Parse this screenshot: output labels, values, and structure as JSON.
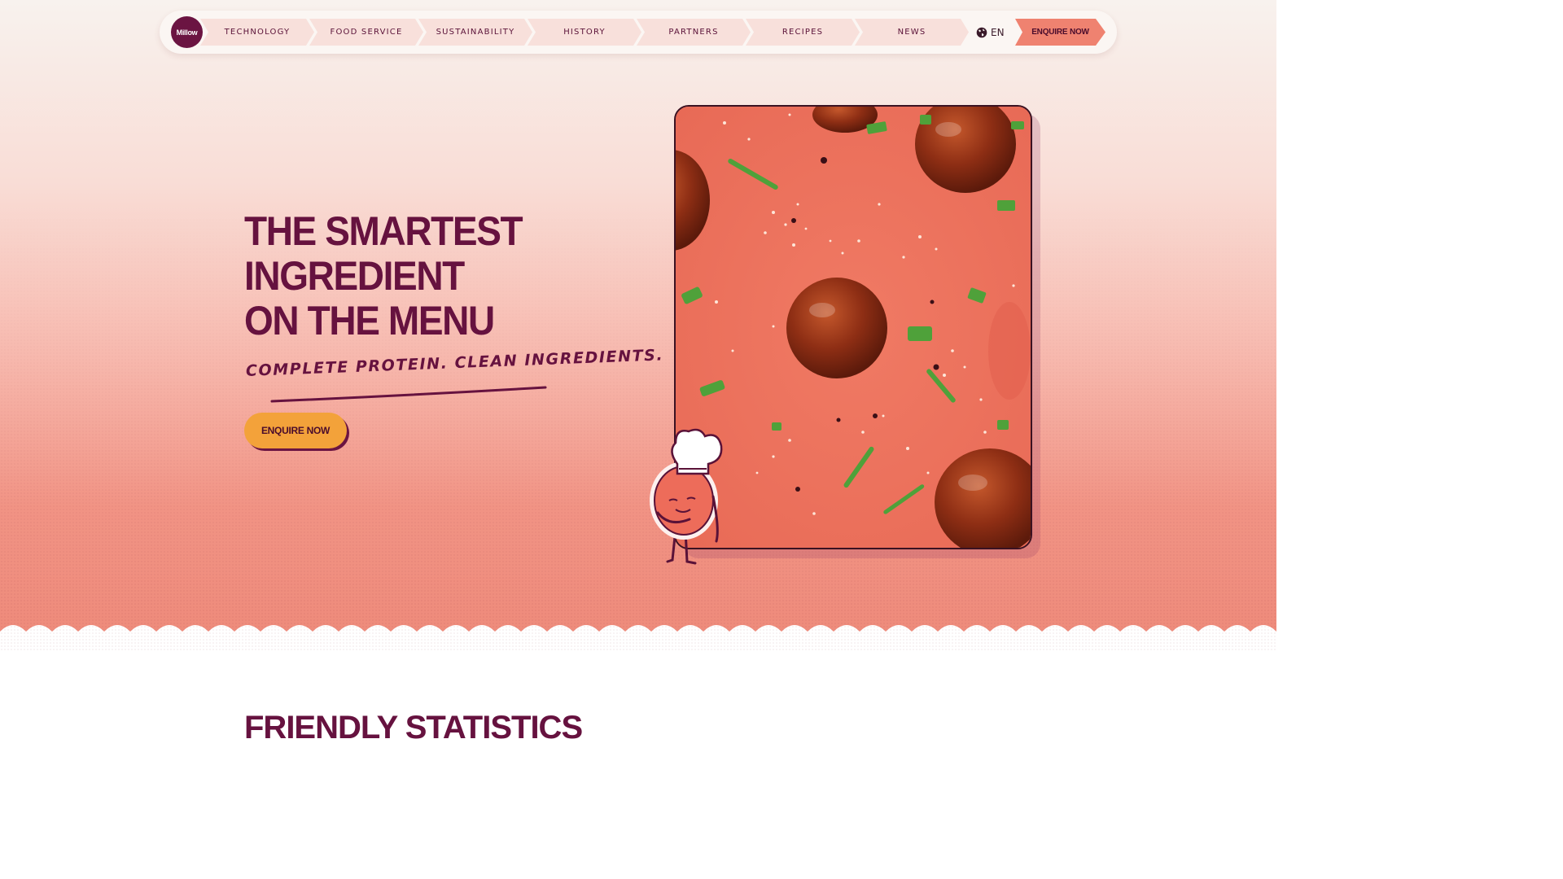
{
  "nav": {
    "logo_text": "Millow",
    "items": [
      {
        "label": "TECHNOLOGY"
      },
      {
        "label": "FOOD SERVICE"
      },
      {
        "label": "SUSTAINABILITY"
      },
      {
        "label": "HISTORY"
      },
      {
        "label": "PARTNERS"
      },
      {
        "label": "RECIPES"
      },
      {
        "label": "NEWS"
      }
    ],
    "language": {
      "icon": "globe-icon",
      "label": "EN"
    },
    "cta_label": "ENQUIRE NOW"
  },
  "hero": {
    "headline": [
      "THE SMARTEST",
      "INGREDIENT",
      "ON THE MENU"
    ],
    "tagline": "COMPLETE PROTEIN. CLEAN INGREDIENTS.",
    "cta_label": "ENQUIRE NOW",
    "image": {
      "subject": "meatballs-photo",
      "mascot": "chef-mascot"
    }
  },
  "next_section": {
    "title_partial": "FRIENDLY STATISTICS"
  },
  "colors": {
    "brand": "#66123f",
    "accent_coral": "#ef8270",
    "cta_orange": "#f3a23a",
    "nav_item_bg": "#f8e0db"
  }
}
